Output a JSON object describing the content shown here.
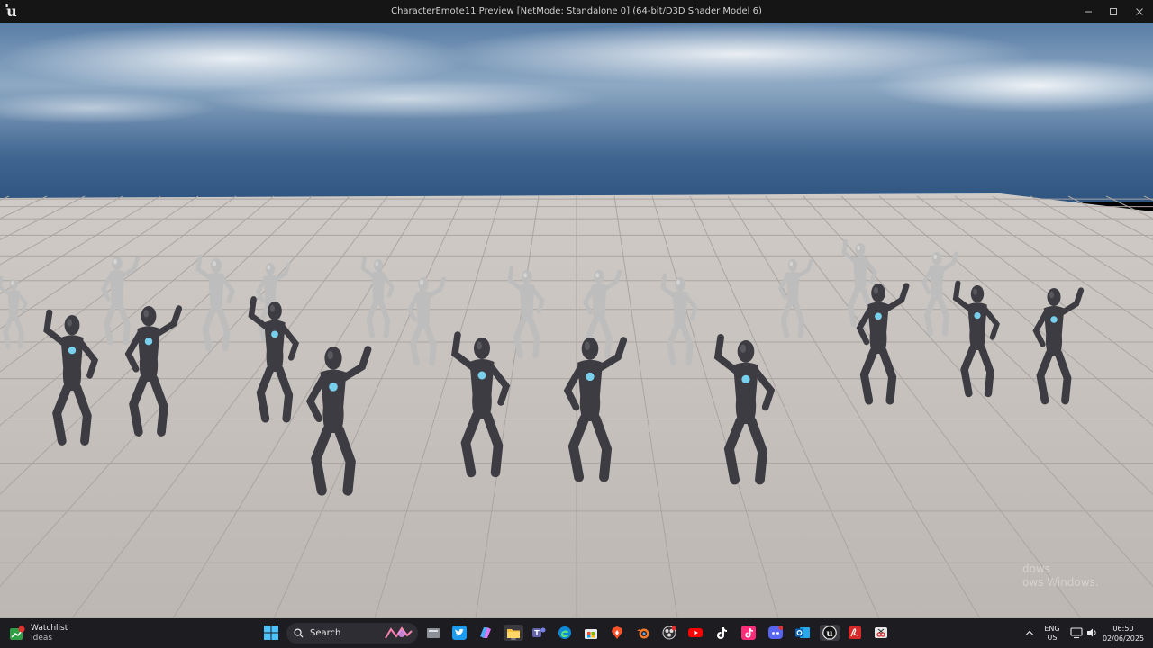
{
  "window": {
    "title": "CharacterEmote11 Preview [NetMode: Standalone 0]  (64-bit/D3D Shader Model 6)"
  },
  "colors": {
    "titlebar": "#151515",
    "taskbar": "#1d1c20",
    "sky_top": "#5c7fa6",
    "floor": "#d8d6d3",
    "mannequin_dark": "#3c3c42",
    "mannequin_light": "#bdbdbd",
    "core_glow": "#7fe0ff"
  },
  "viewport": {
    "watermark_line1": "dows",
    "watermark_line2": "ows Windows."
  },
  "taskbar": {
    "widget_title": "Watchlist",
    "widget_subtitle": "Ideas",
    "search_placeholder": "Search",
    "language_line1": "ENG",
    "language_line2": "US",
    "time": "06:50",
    "date": "02/06/2025",
    "apps": [
      "start-icon",
      "search-icon",
      "file-manager-icon",
      "twitter-icon",
      "copilot-icon",
      "file-explorer-icon",
      "teams-icon",
      "edge-icon",
      "store-icon",
      "brave-icon",
      "blender-icon",
      "obs-icon",
      "youtube-icon",
      "tiktok-icon",
      "tiktok-alt-icon",
      "discord-icon",
      "outlook-icon",
      "unreal-engine-icon",
      "acrobat-icon",
      "snip-icon"
    ]
  }
}
